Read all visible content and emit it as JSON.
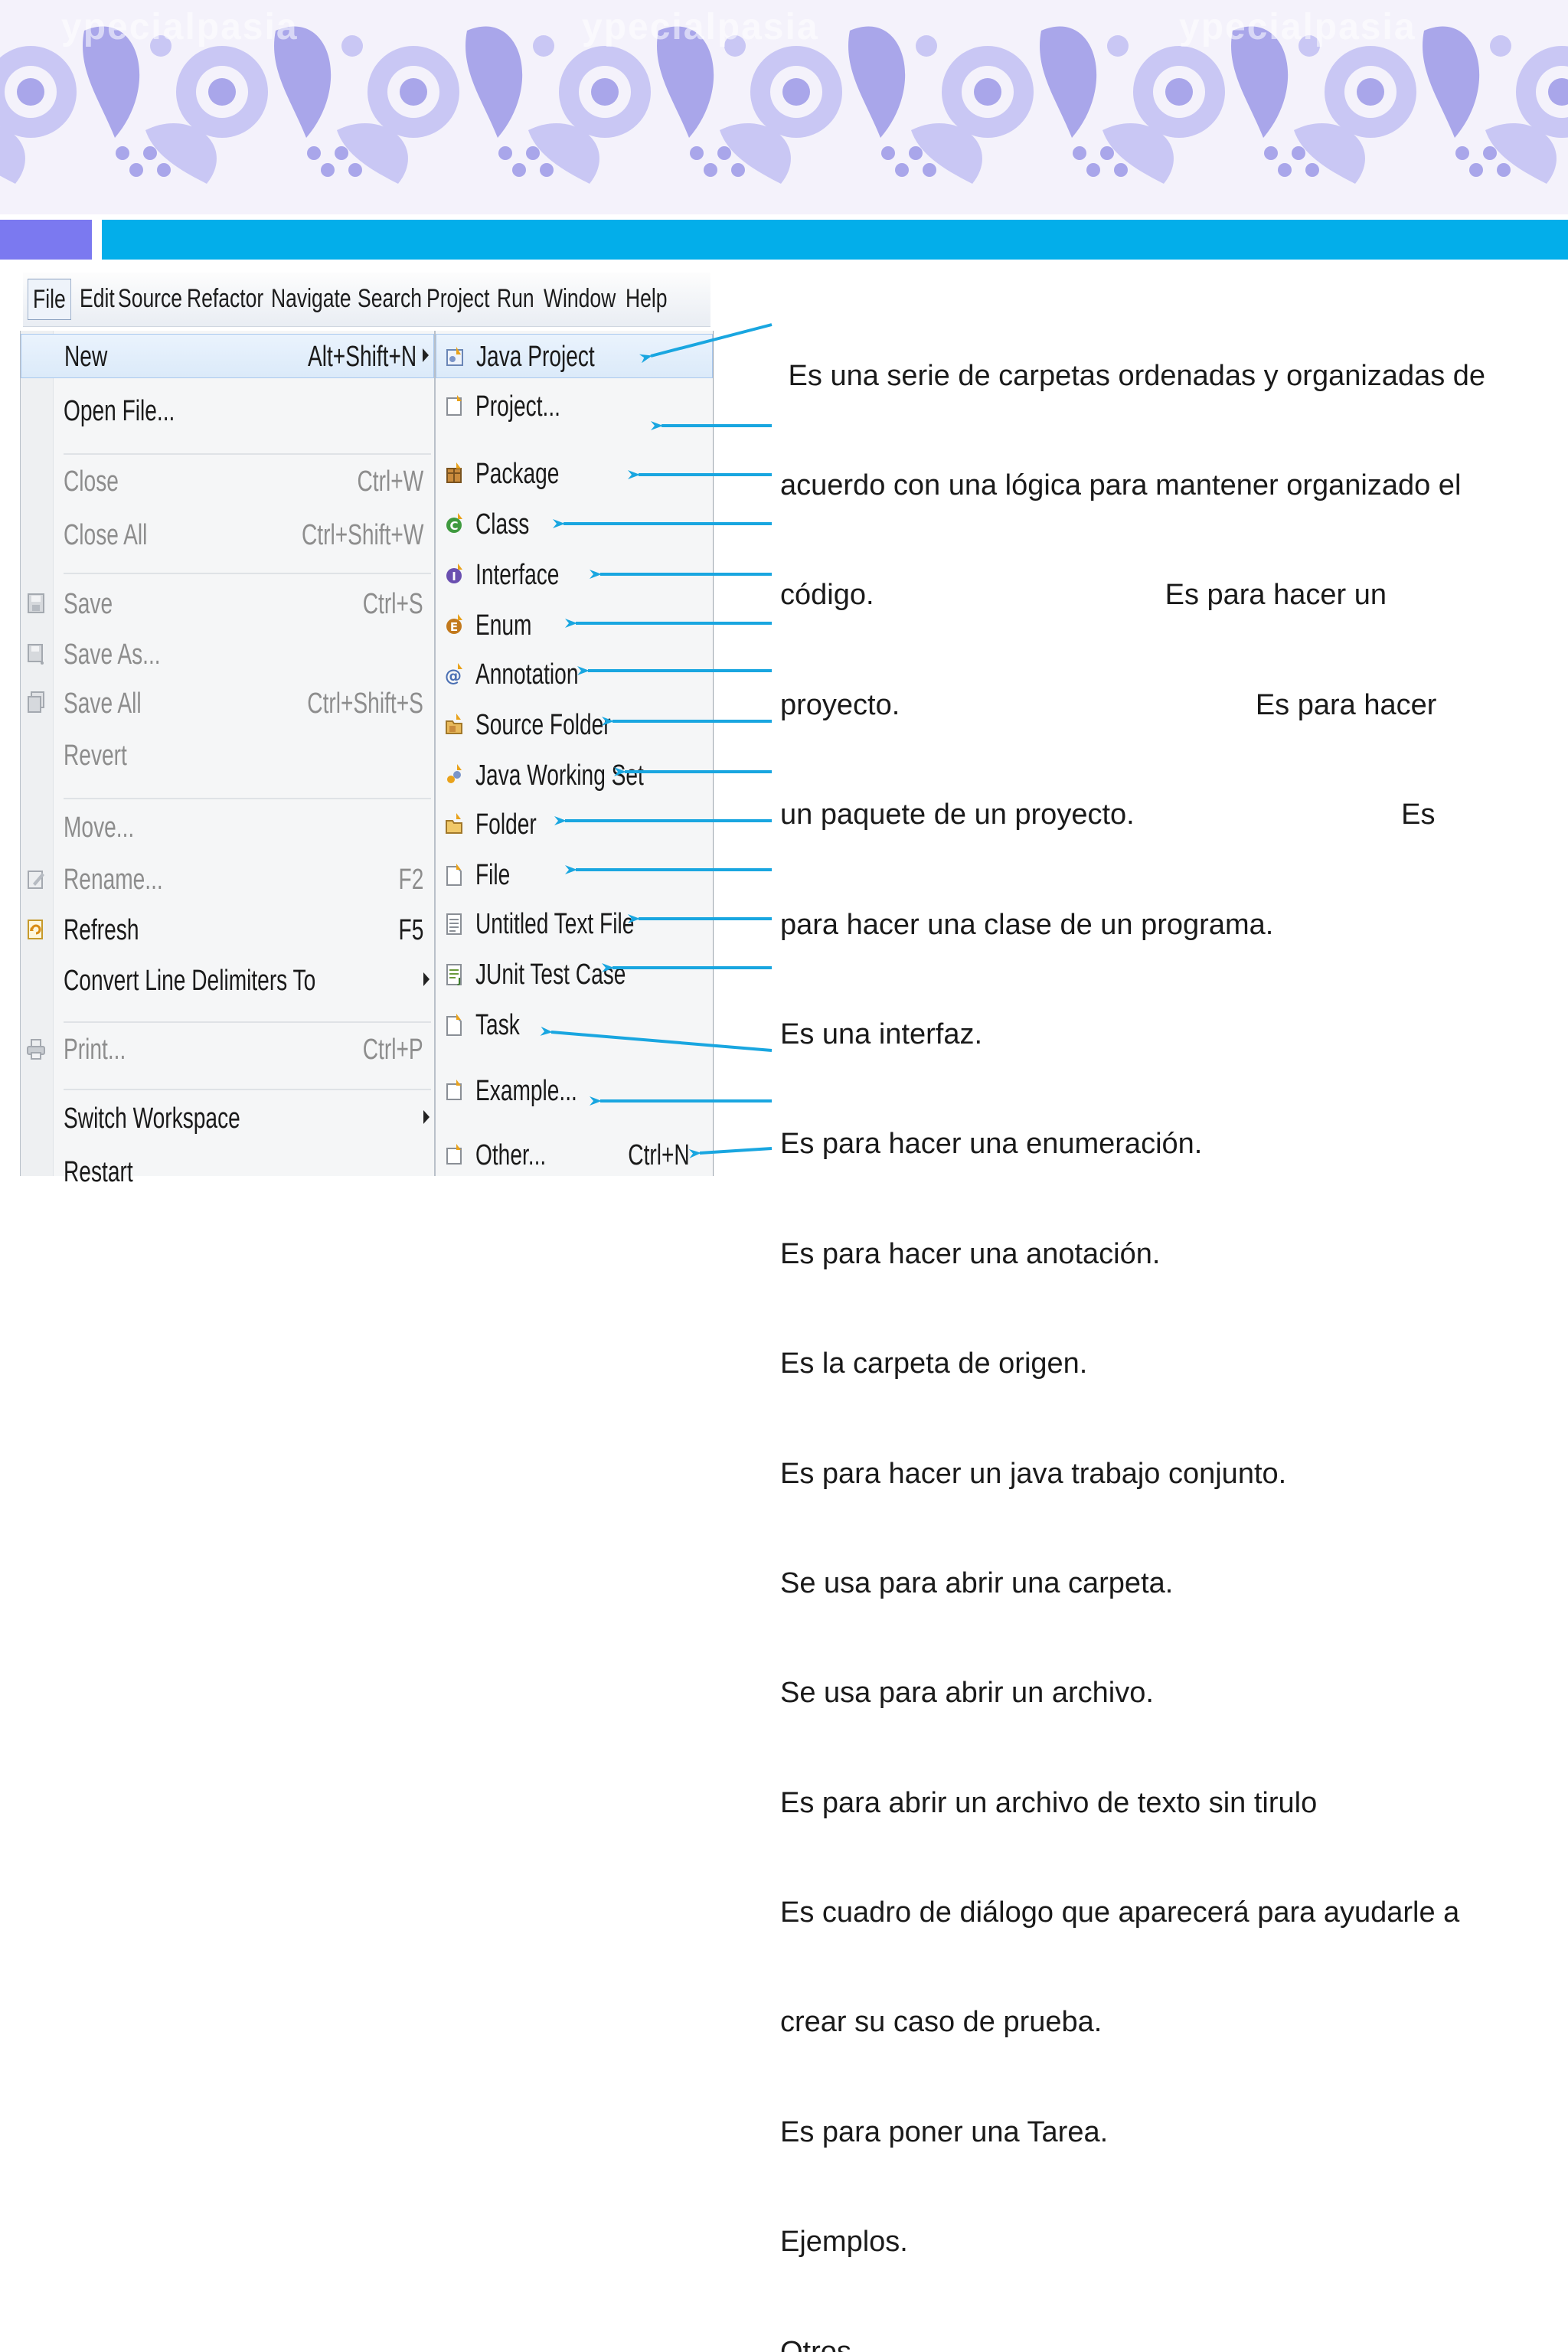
{
  "banner": {
    "watermarks": [
      "ypecialpasia",
      "ypecialpasia",
      "ypecialpasia"
    ],
    "colors": {
      "background": "#f4f2fb",
      "motif": "#a9a6ea",
      "motif_light": "#c9c7f4"
    }
  },
  "accent_bars": {
    "left_color": "#7b79f0",
    "right_color": "#03aeea"
  },
  "menubar": {
    "items": [
      "File",
      "Edit",
      "Source",
      "Refactor",
      "Navigate",
      "Search",
      "Project",
      "Run",
      "Window",
      "Help"
    ]
  },
  "file_menu": {
    "items": [
      {
        "label": "New",
        "shortcut": "Alt+Shift+N",
        "submenu": true,
        "enabled": true,
        "icon": ""
      },
      {
        "label": "Open File...",
        "shortcut": "",
        "enabled": true,
        "icon": ""
      },
      {
        "label": "Close",
        "shortcut": "Ctrl+W",
        "enabled": false,
        "icon": ""
      },
      {
        "label": "Close All",
        "shortcut": "Ctrl+Shift+W",
        "enabled": false,
        "icon": ""
      },
      {
        "label": "Save",
        "shortcut": "Ctrl+S",
        "enabled": false,
        "icon": "save-icon"
      },
      {
        "label": "Save As...",
        "shortcut": "",
        "enabled": false,
        "icon": "save-as-icon"
      },
      {
        "label": "Save All",
        "shortcut": "Ctrl+Shift+S",
        "enabled": false,
        "icon": "save-all-icon"
      },
      {
        "label": "Revert",
        "shortcut": "",
        "enabled": false,
        "icon": ""
      },
      {
        "label": "Move...",
        "shortcut": "",
        "enabled": false,
        "icon": ""
      },
      {
        "label": "Rename...",
        "shortcut": "F2",
        "enabled": false,
        "icon": "rename-icon"
      },
      {
        "label": "Refresh",
        "shortcut": "F5",
        "enabled": true,
        "icon": "refresh-icon"
      },
      {
        "label": "Convert Line Delimiters To",
        "shortcut": "",
        "submenu": true,
        "enabled": true,
        "icon": ""
      },
      {
        "label": "Print...",
        "shortcut": "Ctrl+P",
        "enabled": false,
        "icon": "print-icon"
      },
      {
        "label": "Switch Workspace",
        "shortcut": "",
        "submenu": true,
        "enabled": true,
        "icon": ""
      },
      {
        "label": "Restart",
        "shortcut": "",
        "enabled": true,
        "icon": ""
      }
    ]
  },
  "new_menu": {
    "items": [
      {
        "label": "Java Project",
        "shortcut": "",
        "icon": "java-project-icon"
      },
      {
        "label": "Project...",
        "shortcut": "",
        "icon": "project-icon"
      },
      {
        "label": "Package",
        "shortcut": "",
        "icon": "package-icon"
      },
      {
        "label": "Class",
        "shortcut": "",
        "icon": "class-icon"
      },
      {
        "label": "Interface",
        "shortcut": "",
        "icon": "interface-icon"
      },
      {
        "label": "Enum",
        "shortcut": "",
        "icon": "enum-icon"
      },
      {
        "label": "Annotation",
        "shortcut": "",
        "icon": "annotation-icon"
      },
      {
        "label": "Source Folder",
        "shortcut": "",
        "icon": "source-folder-icon"
      },
      {
        "label": "Java Working Set",
        "shortcut": "",
        "icon": "java-working-set-icon"
      },
      {
        "label": "Folder",
        "shortcut": "",
        "icon": "folder-icon"
      },
      {
        "label": "File",
        "shortcut": "",
        "icon": "file-icon"
      },
      {
        "label": "Untitled Text File",
        "shortcut": "",
        "icon": "text-file-icon"
      },
      {
        "label": "JUnit Test Case",
        "shortcut": "",
        "icon": "junit-icon"
      },
      {
        "label": "Task",
        "shortcut": "",
        "icon": "task-icon"
      },
      {
        "label": "Example...",
        "shortcut": "",
        "icon": "example-icon"
      },
      {
        "label": "Other...",
        "shortcut": "Ctrl+N",
        "icon": "other-icon"
      }
    ]
  },
  "descriptions": {
    "lines": [
      " Es una serie de carpetas ordenadas y organizadas de",
      "acuerdo con una lógica para mantener organizado el",
      "código.                                    Es para hacer un",
      "proyecto.                                            Es para hacer",
      "un paquete de un proyecto.                                 Es",
      "para hacer una clase de un programa.",
      "Es una interfaz.",
      "Es para hacer una enumeración.",
      "Es para hacer una anotación.",
      "Es la carpeta de origen.",
      "Es para hacer un java trabajo conjunto.",
      "Se usa para abrir una carpeta.",
      "Se usa para abrir un archivo.",
      "Es para abrir un archivo de texto sin tirulo",
      "Es cuadro de diálogo que aparecerá para ayudarle a",
      "crear su caso de prueba.",
      "Es para poner una Tarea.",
      "Ejemplos.",
      "Otros."
    ],
    "arrow_color": "#19a6e0"
  }
}
